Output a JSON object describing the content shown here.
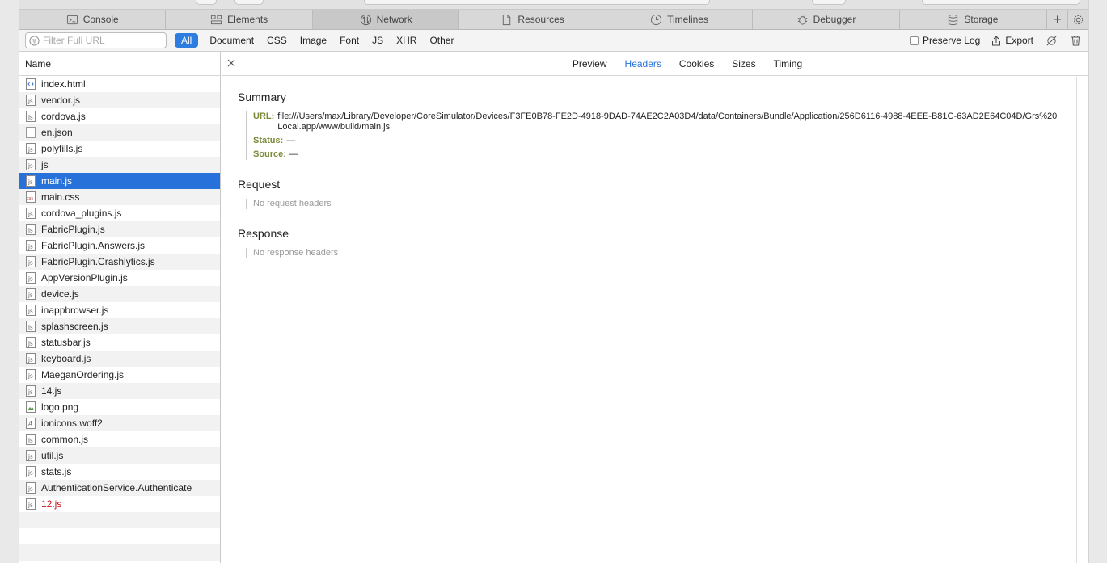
{
  "tabs": [
    {
      "label": "Console",
      "icon": "console-icon"
    },
    {
      "label": "Elements",
      "icon": "elements-icon"
    },
    {
      "label": "Network",
      "icon": "network-icon",
      "active": true
    },
    {
      "label": "Resources",
      "icon": "resources-icon"
    },
    {
      "label": "Timelines",
      "icon": "timelines-icon"
    },
    {
      "label": "Debugger",
      "icon": "debugger-icon"
    },
    {
      "label": "Storage",
      "icon": "storage-icon"
    }
  ],
  "filter": {
    "placeholder": "Filter Full URL",
    "types": [
      "All",
      "Document",
      "CSS",
      "Image",
      "Font",
      "JS",
      "XHR",
      "Other"
    ],
    "active_type": "All",
    "preserve_log_label": "Preserve Log",
    "export_label": "Export"
  },
  "list": {
    "header": "Name",
    "items": [
      {
        "name": "index.html",
        "type": "html"
      },
      {
        "name": "vendor.js",
        "type": "js"
      },
      {
        "name": "cordova.js",
        "type": "js"
      },
      {
        "name": "en.json",
        "type": "doc"
      },
      {
        "name": "polyfills.js",
        "type": "js"
      },
      {
        "name": "js",
        "type": "js"
      },
      {
        "name": "main.js",
        "type": "js",
        "selected": true
      },
      {
        "name": "main.css",
        "type": "css"
      },
      {
        "name": "cordova_plugins.js",
        "type": "js"
      },
      {
        "name": "FabricPlugin.js",
        "type": "js"
      },
      {
        "name": "FabricPlugin.Answers.js",
        "type": "js"
      },
      {
        "name": "FabricPlugin.Crashlytics.js",
        "type": "js"
      },
      {
        "name": "AppVersionPlugin.js",
        "type": "js"
      },
      {
        "name": "device.js",
        "type": "js"
      },
      {
        "name": "inappbrowser.js",
        "type": "js"
      },
      {
        "name": "splashscreen.js",
        "type": "js"
      },
      {
        "name": "statusbar.js",
        "type": "js"
      },
      {
        "name": "keyboard.js",
        "type": "js"
      },
      {
        "name": "MaeganOrdering.js",
        "type": "js"
      },
      {
        "name": "14.js",
        "type": "js"
      },
      {
        "name": "logo.png",
        "type": "image"
      },
      {
        "name": "ionicons.woff2",
        "type": "font"
      },
      {
        "name": "common.js",
        "type": "js"
      },
      {
        "name": "util.js",
        "type": "js"
      },
      {
        "name": "stats.js",
        "type": "js"
      },
      {
        "name": "AuthenticationService.Authenticate",
        "type": "js"
      },
      {
        "name": "12.js",
        "type": "js",
        "error": true
      }
    ]
  },
  "detail": {
    "tabs": [
      "Preview",
      "Headers",
      "Cookies",
      "Sizes",
      "Timing"
    ],
    "active_tab": "Headers",
    "summary": {
      "title": "Summary",
      "url_label": "URL:",
      "url": "file:///Users/max/Library/Developer/CoreSimulator/Devices/F3FE0B78-FE2D-4918-9DAD-74AE2C2A03D4/data/Containers/Bundle/Application/256D6116-4988-4EEE-B81C-63AD2E64C04D/Grs%20Local.app/www/build/main.js",
      "status_label": "Status:",
      "status": "—",
      "source_label": "Source:",
      "source": "—"
    },
    "request": {
      "title": "Request",
      "empty": "No request headers"
    },
    "response": {
      "title": "Response",
      "empty": "No response headers"
    }
  },
  "colors": {
    "accent": "#2672da",
    "error": "#c4161c",
    "key": "#7a8a3a"
  }
}
